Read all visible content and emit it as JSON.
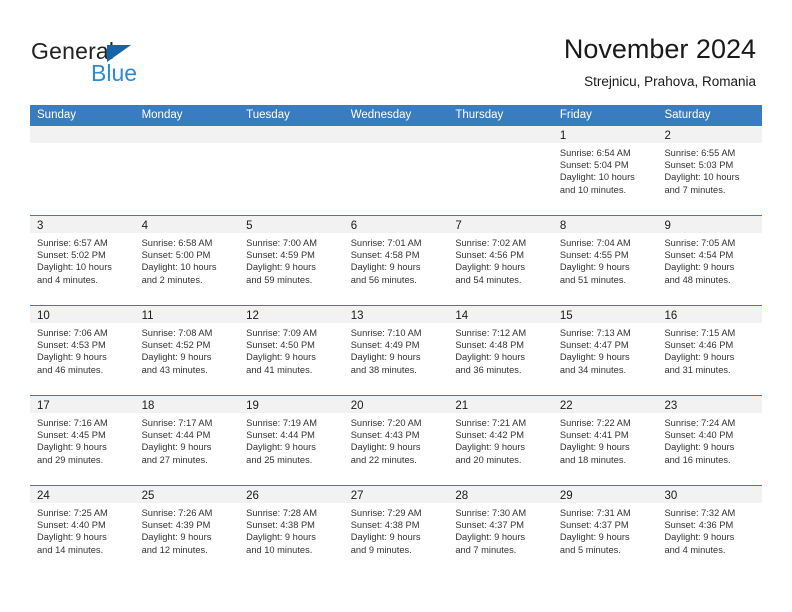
{
  "brand": {
    "name_part1": "General",
    "name_part2": "Blue",
    "triangle_color": "#1464aa",
    "blue_color": "#2e8ad4"
  },
  "header": {
    "title": "November 2024",
    "subtitle": "Strejnicu, Prahova, Romania"
  },
  "theme": {
    "header_band": "#3a7cc0",
    "day_band": "#f2f2f2",
    "text": "#1a1a1a"
  },
  "weekdays": [
    "Sunday",
    "Monday",
    "Tuesday",
    "Wednesday",
    "Thursday",
    "Friday",
    "Saturday"
  ],
  "weeks": [
    [
      {
        "day": "",
        "lines": []
      },
      {
        "day": "",
        "lines": []
      },
      {
        "day": "",
        "lines": []
      },
      {
        "day": "",
        "lines": []
      },
      {
        "day": "",
        "lines": []
      },
      {
        "day": "1",
        "lines": [
          "Sunrise: 6:54 AM",
          "Sunset: 5:04 PM",
          "Daylight: 10 hours",
          "and 10 minutes."
        ]
      },
      {
        "day": "2",
        "lines": [
          "Sunrise: 6:55 AM",
          "Sunset: 5:03 PM",
          "Daylight: 10 hours",
          "and 7 minutes."
        ]
      }
    ],
    [
      {
        "day": "3",
        "lines": [
          "Sunrise: 6:57 AM",
          "Sunset: 5:02 PM",
          "Daylight: 10 hours",
          "and 4 minutes."
        ]
      },
      {
        "day": "4",
        "lines": [
          "Sunrise: 6:58 AM",
          "Sunset: 5:00 PM",
          "Daylight: 10 hours",
          "and 2 minutes."
        ]
      },
      {
        "day": "5",
        "lines": [
          "Sunrise: 7:00 AM",
          "Sunset: 4:59 PM",
          "Daylight: 9 hours",
          "and 59 minutes."
        ]
      },
      {
        "day": "6",
        "lines": [
          "Sunrise: 7:01 AM",
          "Sunset: 4:58 PM",
          "Daylight: 9 hours",
          "and 56 minutes."
        ]
      },
      {
        "day": "7",
        "lines": [
          "Sunrise: 7:02 AM",
          "Sunset: 4:56 PM",
          "Daylight: 9 hours",
          "and 54 minutes."
        ]
      },
      {
        "day": "8",
        "lines": [
          "Sunrise: 7:04 AM",
          "Sunset: 4:55 PM",
          "Daylight: 9 hours",
          "and 51 minutes."
        ]
      },
      {
        "day": "9",
        "lines": [
          "Sunrise: 7:05 AM",
          "Sunset: 4:54 PM",
          "Daylight: 9 hours",
          "and 48 minutes."
        ]
      }
    ],
    [
      {
        "day": "10",
        "lines": [
          "Sunrise: 7:06 AM",
          "Sunset: 4:53 PM",
          "Daylight: 9 hours",
          "and 46 minutes."
        ]
      },
      {
        "day": "11",
        "lines": [
          "Sunrise: 7:08 AM",
          "Sunset: 4:52 PM",
          "Daylight: 9 hours",
          "and 43 minutes."
        ]
      },
      {
        "day": "12",
        "lines": [
          "Sunrise: 7:09 AM",
          "Sunset: 4:50 PM",
          "Daylight: 9 hours",
          "and 41 minutes."
        ]
      },
      {
        "day": "13",
        "lines": [
          "Sunrise: 7:10 AM",
          "Sunset: 4:49 PM",
          "Daylight: 9 hours",
          "and 38 minutes."
        ]
      },
      {
        "day": "14",
        "lines": [
          "Sunrise: 7:12 AM",
          "Sunset: 4:48 PM",
          "Daylight: 9 hours",
          "and 36 minutes."
        ]
      },
      {
        "day": "15",
        "lines": [
          "Sunrise: 7:13 AM",
          "Sunset: 4:47 PM",
          "Daylight: 9 hours",
          "and 34 minutes."
        ]
      },
      {
        "day": "16",
        "lines": [
          "Sunrise: 7:15 AM",
          "Sunset: 4:46 PM",
          "Daylight: 9 hours",
          "and 31 minutes."
        ]
      }
    ],
    [
      {
        "day": "17",
        "lines": [
          "Sunrise: 7:16 AM",
          "Sunset: 4:45 PM",
          "Daylight: 9 hours",
          "and 29 minutes."
        ]
      },
      {
        "day": "18",
        "lines": [
          "Sunrise: 7:17 AM",
          "Sunset: 4:44 PM",
          "Daylight: 9 hours",
          "and 27 minutes."
        ]
      },
      {
        "day": "19",
        "lines": [
          "Sunrise: 7:19 AM",
          "Sunset: 4:44 PM",
          "Daylight: 9 hours",
          "and 25 minutes."
        ]
      },
      {
        "day": "20",
        "lines": [
          "Sunrise: 7:20 AM",
          "Sunset: 4:43 PM",
          "Daylight: 9 hours",
          "and 22 minutes."
        ]
      },
      {
        "day": "21",
        "lines": [
          "Sunrise: 7:21 AM",
          "Sunset: 4:42 PM",
          "Daylight: 9 hours",
          "and 20 minutes."
        ]
      },
      {
        "day": "22",
        "lines": [
          "Sunrise: 7:22 AM",
          "Sunset: 4:41 PM",
          "Daylight: 9 hours",
          "and 18 minutes."
        ]
      },
      {
        "day": "23",
        "lines": [
          "Sunrise: 7:24 AM",
          "Sunset: 4:40 PM",
          "Daylight: 9 hours",
          "and 16 minutes."
        ]
      }
    ],
    [
      {
        "day": "24",
        "lines": [
          "Sunrise: 7:25 AM",
          "Sunset: 4:40 PM",
          "Daylight: 9 hours",
          "and 14 minutes."
        ]
      },
      {
        "day": "25",
        "lines": [
          "Sunrise: 7:26 AM",
          "Sunset: 4:39 PM",
          "Daylight: 9 hours",
          "and 12 minutes."
        ]
      },
      {
        "day": "26",
        "lines": [
          "Sunrise: 7:28 AM",
          "Sunset: 4:38 PM",
          "Daylight: 9 hours",
          "and 10 minutes."
        ]
      },
      {
        "day": "27",
        "lines": [
          "Sunrise: 7:29 AM",
          "Sunset: 4:38 PM",
          "Daylight: 9 hours",
          "and 9 minutes."
        ]
      },
      {
        "day": "28",
        "lines": [
          "Sunrise: 7:30 AM",
          "Sunset: 4:37 PM",
          "Daylight: 9 hours",
          "and 7 minutes."
        ]
      },
      {
        "day": "29",
        "lines": [
          "Sunrise: 7:31 AM",
          "Sunset: 4:37 PM",
          "Daylight: 9 hours",
          "and 5 minutes."
        ]
      },
      {
        "day": "30",
        "lines": [
          "Sunrise: 7:32 AM",
          "Sunset: 4:36 PM",
          "Daylight: 9 hours",
          "and 4 minutes."
        ]
      }
    ]
  ]
}
